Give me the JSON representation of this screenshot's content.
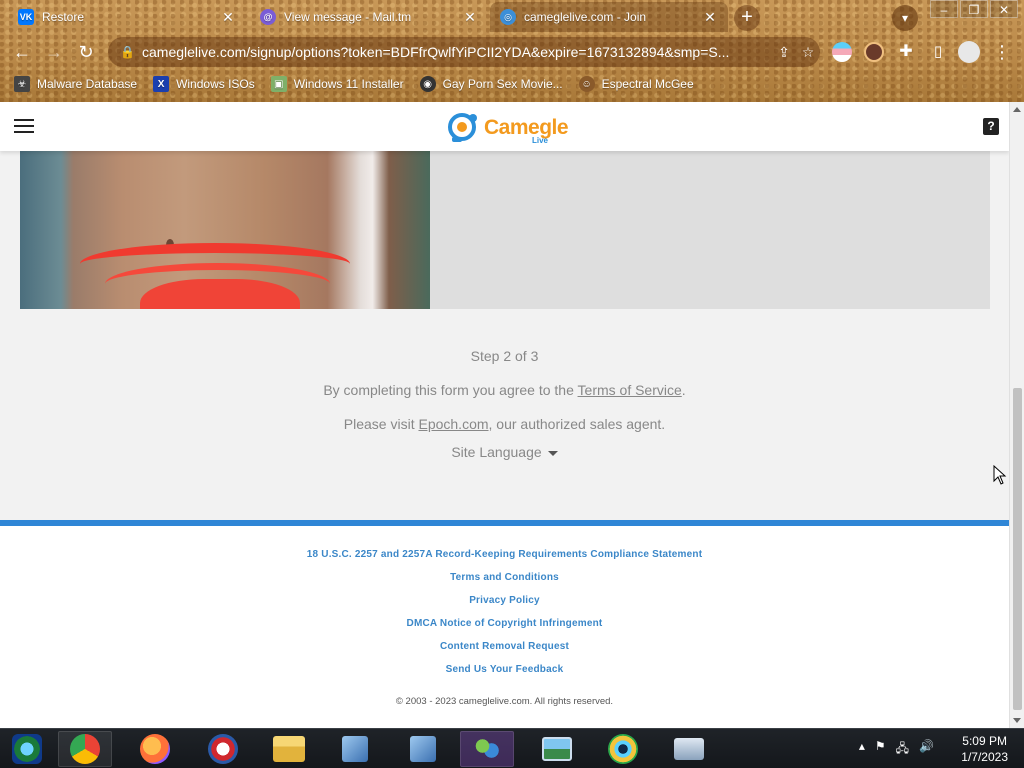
{
  "browser": {
    "tabs": [
      {
        "title": "Restore",
        "icon": "vk-icon",
        "active": false
      },
      {
        "title": "View message - Mail.tm",
        "icon": "mailtm-icon",
        "active": false
      },
      {
        "title": "cameglelive.com - Join",
        "icon": "globe-icon",
        "active": true
      }
    ],
    "new_tab": "+",
    "url": "cameglelive.com/signup/options?token=BDFfrQwlfYiPCII2YDA&expire=1673132894&smp=S...",
    "bookmarks": [
      {
        "label": "Malware Database",
        "icon": "malware-icon"
      },
      {
        "label": "Windows ISOs",
        "icon": "x-icon"
      },
      {
        "label": "Windows 11 Installer",
        "icon": "image-icon"
      },
      {
        "label": "Gay Porn Sex Movie...",
        "icon": "globe-icon"
      },
      {
        "label": "Espectral McGee",
        "icon": "character-icon"
      }
    ]
  },
  "site": {
    "logo_text": "Camegle",
    "logo_sub": "Live",
    "help": "?",
    "step": "Step 2 of 3",
    "agree_prefix": "By completing this form you agree to the ",
    "agree_link": "Terms of Service",
    "agree_suffix": ".",
    "visit_prefix": "Please visit ",
    "visit_link": "Epoch.com",
    "visit_suffix": ", our authorized sales agent.",
    "language": "Site Language",
    "footer_links": [
      "18 U.S.C. 2257 and 2257A Record-Keeping Requirements Compliance Statement",
      "Terms and Conditions",
      "Privacy Policy",
      "DMCA Notice of Copyright Infringement",
      "Content Removal Request",
      "Send Us Your Feedback"
    ],
    "copyright": "© 2003 - 2023 cameglelive.com. All rights reserved."
  },
  "taskbar": {
    "apps": [
      "media-center-icon",
      "chrome-icon",
      "firefox-icon",
      "opera-icon",
      "file-explorer-icon",
      "network-tool-icon",
      "network-tool-icon",
      "messenger-icon",
      "photo-viewer-icon",
      "camera-app-icon",
      "keyboard-icon"
    ],
    "time": "5:09 PM",
    "date": "1/7/2023"
  },
  "colors": {
    "accent_blue": "#2f86d6",
    "logo_orange": "#f39a1e",
    "link_blue": "#3b87c8"
  }
}
